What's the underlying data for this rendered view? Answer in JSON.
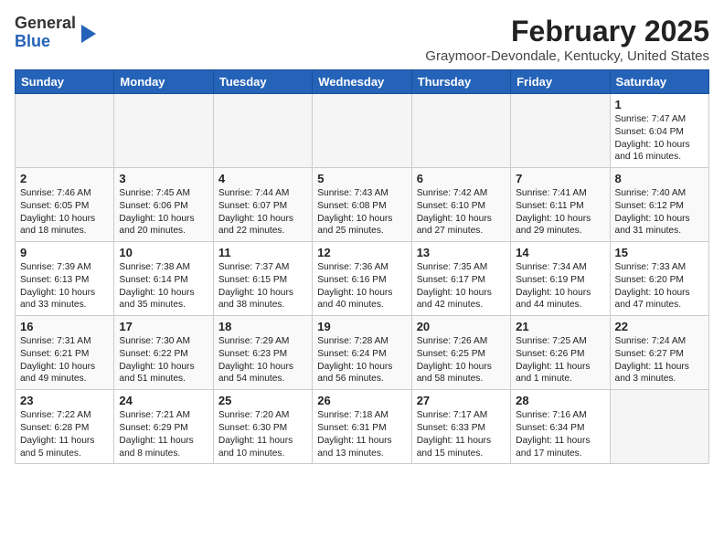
{
  "logo": {
    "general": "General",
    "blue": "Blue"
  },
  "title": "February 2025",
  "location": "Graymoor-Devondale, Kentucky, United States",
  "headers": [
    "Sunday",
    "Monday",
    "Tuesday",
    "Wednesday",
    "Thursday",
    "Friday",
    "Saturday"
  ],
  "weeks": [
    [
      {
        "day": "",
        "info": ""
      },
      {
        "day": "",
        "info": ""
      },
      {
        "day": "",
        "info": ""
      },
      {
        "day": "",
        "info": ""
      },
      {
        "day": "",
        "info": ""
      },
      {
        "day": "",
        "info": ""
      },
      {
        "day": "1",
        "info": "Sunrise: 7:47 AM\nSunset: 6:04 PM\nDaylight: 10 hours and 16 minutes."
      }
    ],
    [
      {
        "day": "2",
        "info": "Sunrise: 7:46 AM\nSunset: 6:05 PM\nDaylight: 10 hours and 18 minutes."
      },
      {
        "day": "3",
        "info": "Sunrise: 7:45 AM\nSunset: 6:06 PM\nDaylight: 10 hours and 20 minutes."
      },
      {
        "day": "4",
        "info": "Sunrise: 7:44 AM\nSunset: 6:07 PM\nDaylight: 10 hours and 22 minutes."
      },
      {
        "day": "5",
        "info": "Sunrise: 7:43 AM\nSunset: 6:08 PM\nDaylight: 10 hours and 25 minutes."
      },
      {
        "day": "6",
        "info": "Sunrise: 7:42 AM\nSunset: 6:10 PM\nDaylight: 10 hours and 27 minutes."
      },
      {
        "day": "7",
        "info": "Sunrise: 7:41 AM\nSunset: 6:11 PM\nDaylight: 10 hours and 29 minutes."
      },
      {
        "day": "8",
        "info": "Sunrise: 7:40 AM\nSunset: 6:12 PM\nDaylight: 10 hours and 31 minutes."
      }
    ],
    [
      {
        "day": "9",
        "info": "Sunrise: 7:39 AM\nSunset: 6:13 PM\nDaylight: 10 hours and 33 minutes."
      },
      {
        "day": "10",
        "info": "Sunrise: 7:38 AM\nSunset: 6:14 PM\nDaylight: 10 hours and 35 minutes."
      },
      {
        "day": "11",
        "info": "Sunrise: 7:37 AM\nSunset: 6:15 PM\nDaylight: 10 hours and 38 minutes."
      },
      {
        "day": "12",
        "info": "Sunrise: 7:36 AM\nSunset: 6:16 PM\nDaylight: 10 hours and 40 minutes."
      },
      {
        "day": "13",
        "info": "Sunrise: 7:35 AM\nSunset: 6:17 PM\nDaylight: 10 hours and 42 minutes."
      },
      {
        "day": "14",
        "info": "Sunrise: 7:34 AM\nSunset: 6:19 PM\nDaylight: 10 hours and 44 minutes."
      },
      {
        "day": "15",
        "info": "Sunrise: 7:33 AM\nSunset: 6:20 PM\nDaylight: 10 hours and 47 minutes."
      }
    ],
    [
      {
        "day": "16",
        "info": "Sunrise: 7:31 AM\nSunset: 6:21 PM\nDaylight: 10 hours and 49 minutes."
      },
      {
        "day": "17",
        "info": "Sunrise: 7:30 AM\nSunset: 6:22 PM\nDaylight: 10 hours and 51 minutes."
      },
      {
        "day": "18",
        "info": "Sunrise: 7:29 AM\nSunset: 6:23 PM\nDaylight: 10 hours and 54 minutes."
      },
      {
        "day": "19",
        "info": "Sunrise: 7:28 AM\nSunset: 6:24 PM\nDaylight: 10 hours and 56 minutes."
      },
      {
        "day": "20",
        "info": "Sunrise: 7:26 AM\nSunset: 6:25 PM\nDaylight: 10 hours and 58 minutes."
      },
      {
        "day": "21",
        "info": "Sunrise: 7:25 AM\nSunset: 6:26 PM\nDaylight: 11 hours and 1 minute."
      },
      {
        "day": "22",
        "info": "Sunrise: 7:24 AM\nSunset: 6:27 PM\nDaylight: 11 hours and 3 minutes."
      }
    ],
    [
      {
        "day": "23",
        "info": "Sunrise: 7:22 AM\nSunset: 6:28 PM\nDaylight: 11 hours and 5 minutes."
      },
      {
        "day": "24",
        "info": "Sunrise: 7:21 AM\nSunset: 6:29 PM\nDaylight: 11 hours and 8 minutes."
      },
      {
        "day": "25",
        "info": "Sunrise: 7:20 AM\nSunset: 6:30 PM\nDaylight: 11 hours and 10 minutes."
      },
      {
        "day": "26",
        "info": "Sunrise: 7:18 AM\nSunset: 6:31 PM\nDaylight: 11 hours and 13 minutes."
      },
      {
        "day": "27",
        "info": "Sunrise: 7:17 AM\nSunset: 6:33 PM\nDaylight: 11 hours and 15 minutes."
      },
      {
        "day": "28",
        "info": "Sunrise: 7:16 AM\nSunset: 6:34 PM\nDaylight: 11 hours and 17 minutes."
      },
      {
        "day": "",
        "info": ""
      }
    ]
  ]
}
